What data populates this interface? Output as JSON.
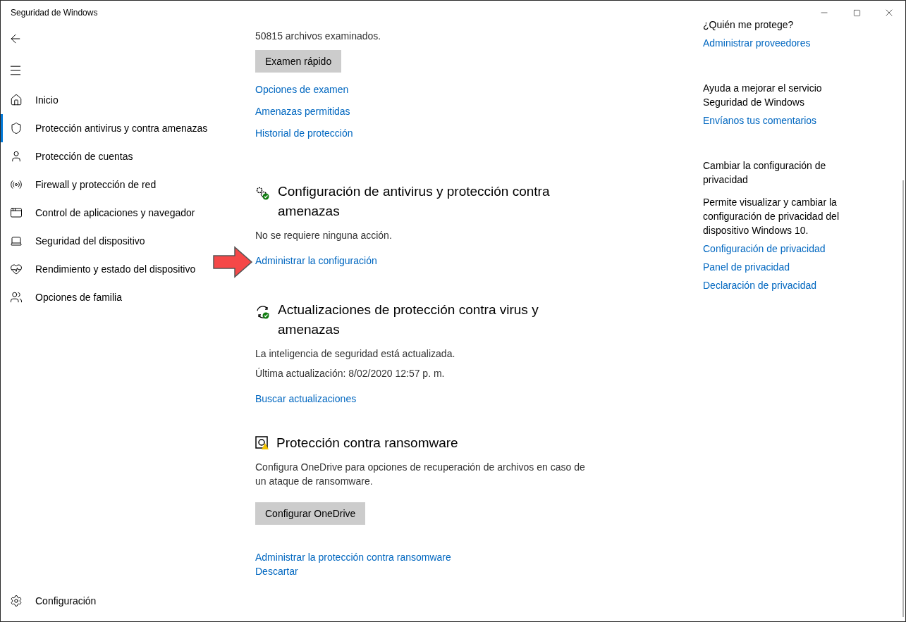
{
  "window": {
    "title": "Seguridad de Windows"
  },
  "sidebar": {
    "items": [
      {
        "label": "Inicio",
        "selected": false
      },
      {
        "label": "Protección antivirus y contra amenazas",
        "selected": true
      },
      {
        "label": "Protección de cuentas",
        "selected": false
      },
      {
        "label": "Firewall y protección de red",
        "selected": false
      },
      {
        "label": "Control de aplicaciones y navegador",
        "selected": false
      },
      {
        "label": "Seguridad del dispositivo",
        "selected": false
      },
      {
        "label": "Rendimiento y estado del dispositivo",
        "selected": false
      },
      {
        "label": "Opciones de familia",
        "selected": false
      }
    ],
    "footer": "Configuración"
  },
  "main": {
    "scan_summary": "50815 archivos examinados.",
    "scan_button": "Examen rápido",
    "links": [
      "Opciones de examen",
      "Amenazas permitidas",
      "Historial de protección"
    ],
    "sections": [
      {
        "title": "Configuración de antivirus y protección contra amenazas",
        "lines": [
          "No se requiere ninguna acción."
        ],
        "links": [
          "Administrar la configuración"
        ]
      },
      {
        "title": "Actualizaciones de protección contra virus y amenazas",
        "lines": [
          "La inteligencia de seguridad está actualizada.",
          "Última actualización: 8/02/2020 12:57 p. m."
        ],
        "links": [
          "Buscar actualizaciones"
        ]
      },
      {
        "title": "Protección contra ransomware",
        "lines": [
          "Configura OneDrive para opciones de recuperación de archivos en caso de un ataque de ransomware."
        ],
        "button": "Configurar OneDrive",
        "links": [
          "Administrar la protección contra ransomware",
          "Descartar"
        ]
      }
    ]
  },
  "aside": [
    {
      "heading": "¿Quién me protege?",
      "links": [
        "Administrar proveedores"
      ]
    },
    {
      "heading": "Ayuda a mejorar el servicio Seguridad de Windows",
      "links": [
        "Envíanos tus comentarios"
      ]
    },
    {
      "heading": "Cambiar la configuración de privacidad",
      "text": "Permite visualizar y cambiar la configuración de privacidad del dispositivo Windows 10.",
      "links": [
        "Configuración de privacidad",
        "Panel de privacidad",
        "Declaración de privacidad"
      ]
    }
  ]
}
